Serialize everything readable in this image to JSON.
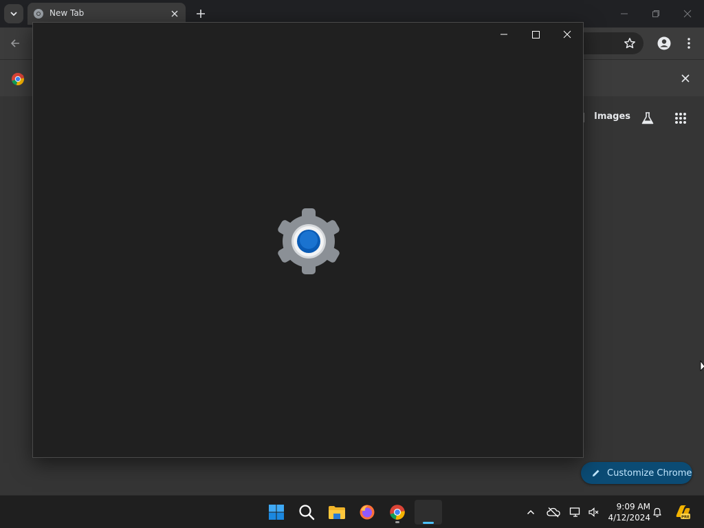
{
  "browser": {
    "tab_title": "New Tab",
    "ntp": {
      "images_label": "Images",
      "customize_label": "Customize Chrome"
    }
  },
  "taskbar": {
    "time": "9:09 AM",
    "date": "4/12/2024",
    "apps": [
      "windows-start",
      "search",
      "file-explorer",
      "firefox",
      "chrome",
      "settings"
    ]
  },
  "colors": {
    "accent_blue": "#0067c0",
    "taskbar_active": "#4cc2ff",
    "customize_bg": "#0b4b74"
  }
}
